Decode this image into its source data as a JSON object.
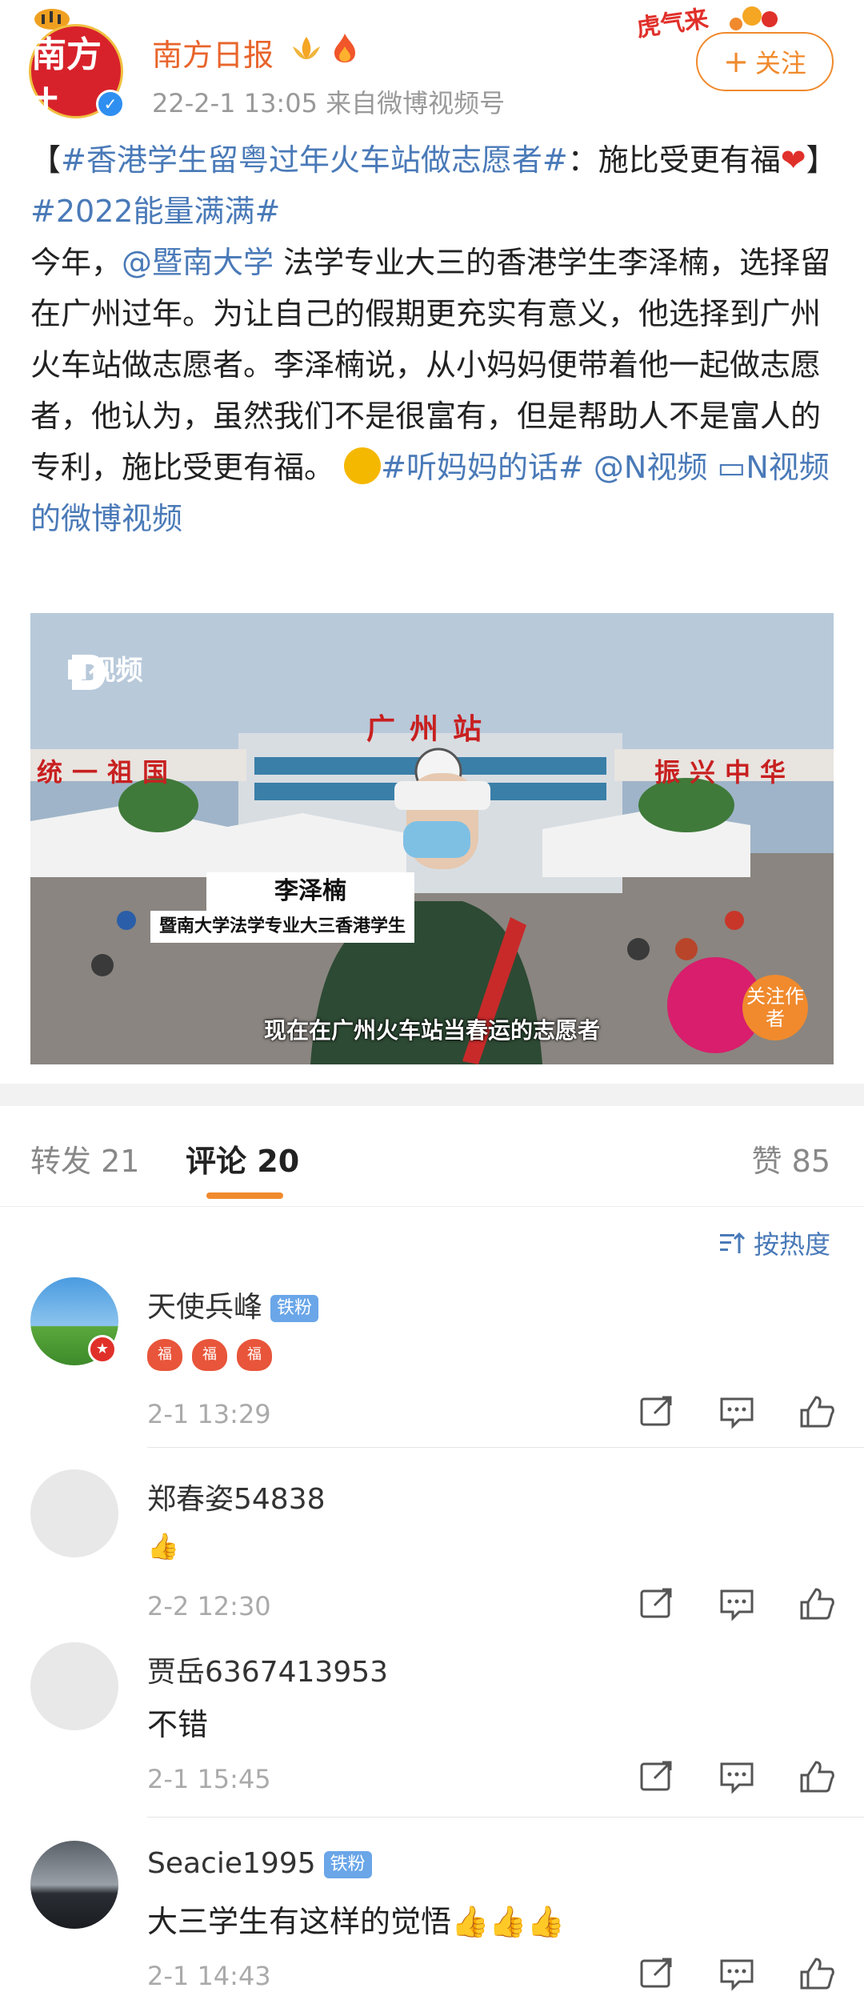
{
  "post": {
    "author": "南方日报",
    "avatar_text": "南方+",
    "time": "22-2-1 13:05",
    "source_prefix": "来自",
    "source": "微博视频号",
    "follow_label": "关注",
    "topic1": "#香港学生留粤过年火车站做志愿者#",
    "topic1_suffix": "：施比受更有福",
    "topic1_open": "【",
    "topic1_close": "】",
    "topic2": "#2022能量满满#",
    "body_pre": "今年，",
    "mention1": "@暨南大学",
    "body_main": " 法学专业大三的香港学生李泽楠，选择留在广州过年。为让自己的假期更充实有意义，他选择到广州火车站做志愿者。李泽楠说，从小妈妈便带着他一起做志愿者，他认为，虽然我们不是很富有，但是帮助人不是富人的专利，施比受更有福。",
    "topic3": "#听妈妈的话#",
    "mention2": "@N视频",
    "video_link": "N视频的微博视频"
  },
  "video": {
    "logo_text": "N视频",
    "station_sign": "广州站",
    "banner_left": "统一祖国",
    "banner_right": "振兴中华",
    "name_caption": "李泽楠",
    "role_caption": "暨南大学法学专业大三香港学生",
    "subtitle": "现在在广州火车站当春运的志愿者",
    "follow_author": "关注作者"
  },
  "tabs": {
    "repost_label": "转发",
    "repost_count": "21",
    "comment_label": "评论",
    "comment_count": "20",
    "like_label": "赞",
    "like_count": "85"
  },
  "sort_label": "按热度",
  "comments": [
    {
      "name": "天使兵峰",
      "badge": "铁粉",
      "text": "",
      "stickers": [
        "福",
        "福",
        "福"
      ],
      "time": "2-1 13:29"
    },
    {
      "name": "郑春姿54838",
      "badge": "",
      "text": "👍",
      "time": "2-2 12:30"
    },
    {
      "name": "贾岳6367413953",
      "badge": "",
      "text": "不错",
      "time": "2-1 15:45"
    },
    {
      "name": "Seacie1995",
      "badge": "铁粉",
      "text": "大三学生有这样的觉悟👍👍👍",
      "time": "2-1 14:43"
    }
  ],
  "colors": {
    "accent": "#f08a2d",
    "link": "#4a7ab8",
    "brand_red": "#d8222b"
  }
}
